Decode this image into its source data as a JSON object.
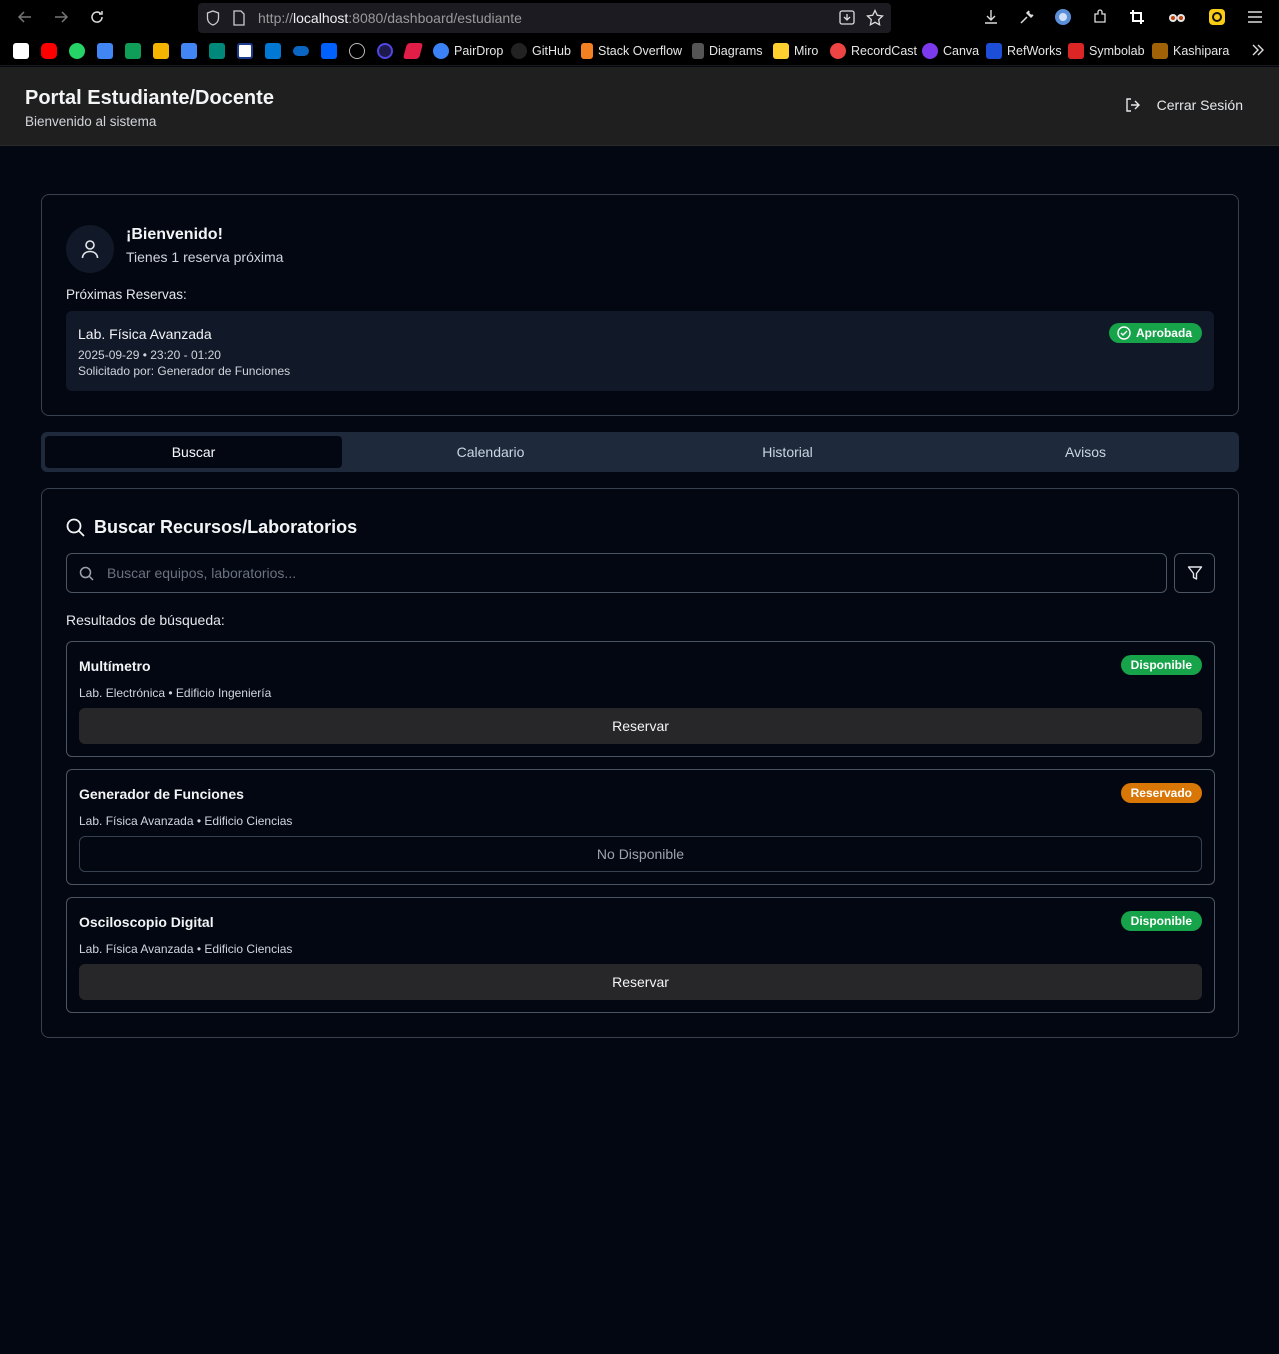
{
  "browser": {
    "url_prefix": "http://",
    "url_host": "localhost",
    "url_rest": ":8080/dashboard/estudiante",
    "bookmarks": [
      "PairDrop",
      "GitHub",
      "Stack Overflow",
      "Diagrams",
      "Miro",
      "RecordCast",
      "Canva",
      "RefWorks",
      "Symbolab",
      "Kashipara"
    ]
  },
  "header": {
    "title": "Portal Estudiante/Docente",
    "subtitle": "Bienvenido al sistema",
    "logout_label": "Cerrar Sesión"
  },
  "welcome": {
    "title": "¡Bienvenido!",
    "subtitle": "Tienes 1 reserva próxima",
    "upcoming_label": "Próximas Reservas:",
    "reservation": {
      "name": "Lab. Física Avanzada",
      "when": "2025-09-29 • 23:20 - 01:20",
      "requested_by": "Solicitado por: Generador de Funciones",
      "status": "Aprobada"
    }
  },
  "tabs": [
    "Buscar",
    "Calendario",
    "Historial",
    "Avisos"
  ],
  "search": {
    "title": "Buscar Recursos/Laboratorios",
    "placeholder": "Buscar equipos, laboratorios...",
    "results_label": "Resultados de búsqueda:",
    "results": [
      {
        "name": "Multímetro",
        "location": "Lab. Electrónica • Edificio Ingeniería",
        "status": "Disponible",
        "action": "Reservar"
      },
      {
        "name": "Generador de Funciones",
        "location": "Lab. Física Avanzada • Edificio Ciencias",
        "status": "Reservado",
        "action": "No Disponible"
      },
      {
        "name": "Osciloscopio Digital",
        "location": "Lab. Física Avanzada • Edificio Ciencias",
        "status": "Disponible",
        "action": "Reservar"
      }
    ]
  },
  "colors": {
    "available": "#16a34a",
    "reserved": "#d97706",
    "background": "#030712",
    "tabs_bg": "#1e293b"
  }
}
